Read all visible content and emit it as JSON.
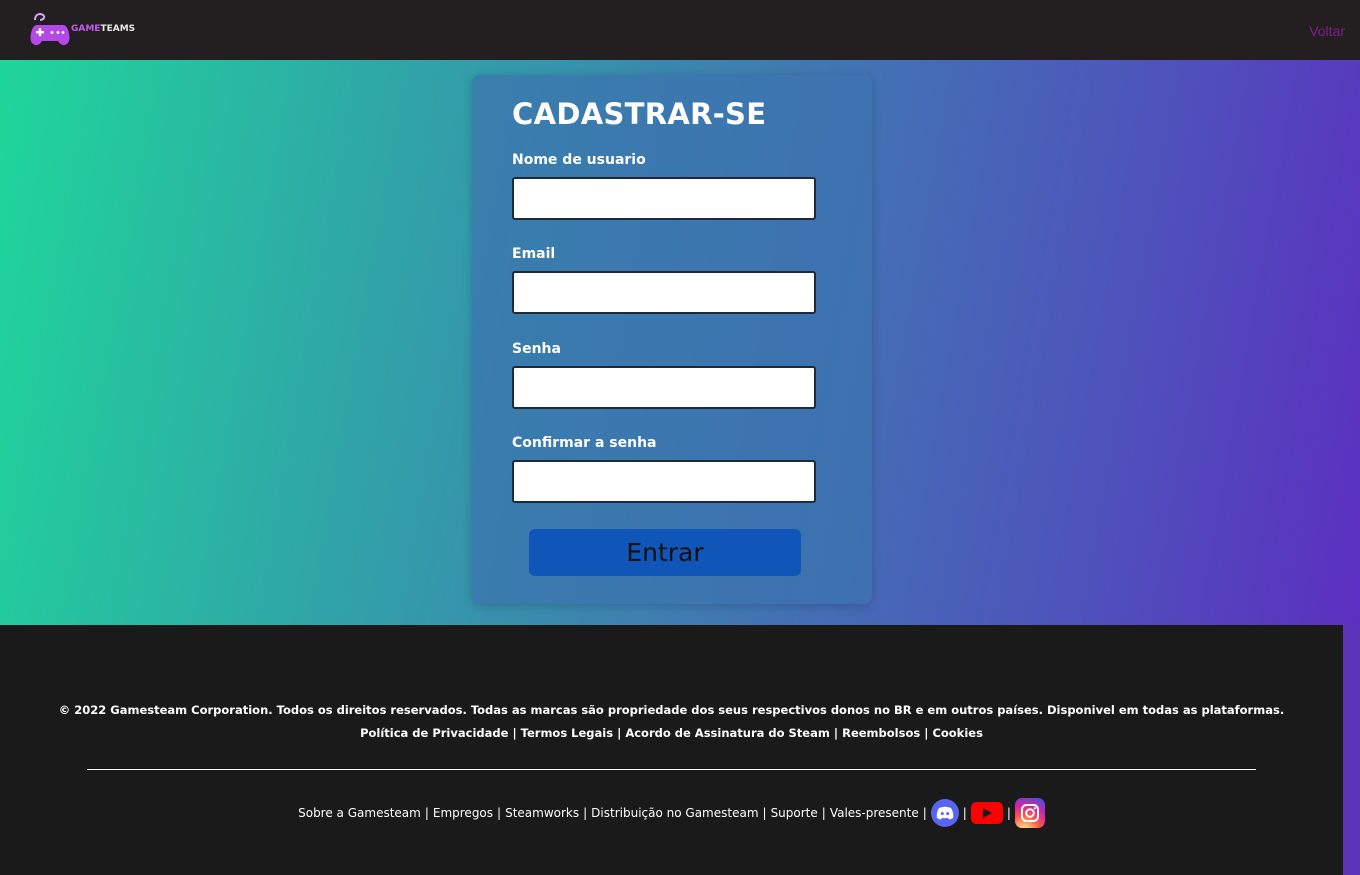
{
  "header": {
    "logo": {
      "part1": "GAME",
      "part2": "TEAMS"
    },
    "back_link": "Voltar"
  },
  "colors": {
    "hero_gradient_start": "#1fd69a",
    "hero_gradient_end": "#5c2fc0",
    "submit_button": "#1055b8",
    "back_link": "#7e1e8c"
  },
  "form": {
    "title": "CADASTRAR-SE",
    "fields": [
      {
        "label": "Nome de usuario",
        "value": ""
      },
      {
        "label": "Email",
        "value": ""
      },
      {
        "label": "Senha",
        "value": ""
      },
      {
        "label": "Confirmar a senha",
        "value": ""
      }
    ],
    "submit_label": "Entrar"
  },
  "footer": {
    "copyright": "© 2022 Gamesteam Corporation. Todos os direitos reservados. Todas as marcas são propriedade dos seus respectivos donos no BR e em outros países. Disponivel em todas as plataformas.",
    "legal_links": [
      "Política de Privacidade",
      "Termos Legais",
      "Acordo de Assinatura do Steam",
      "Reembolsos",
      "Cookies"
    ],
    "bottom_links": [
      "Sobre a Gamesteam",
      "Empregos",
      "Steamworks",
      "Distribuição no Gamesteam",
      "Suporte",
      "Vales-presente"
    ],
    "social_icons": [
      "discord-icon",
      "youtube-icon",
      "instagram-icon"
    ]
  }
}
